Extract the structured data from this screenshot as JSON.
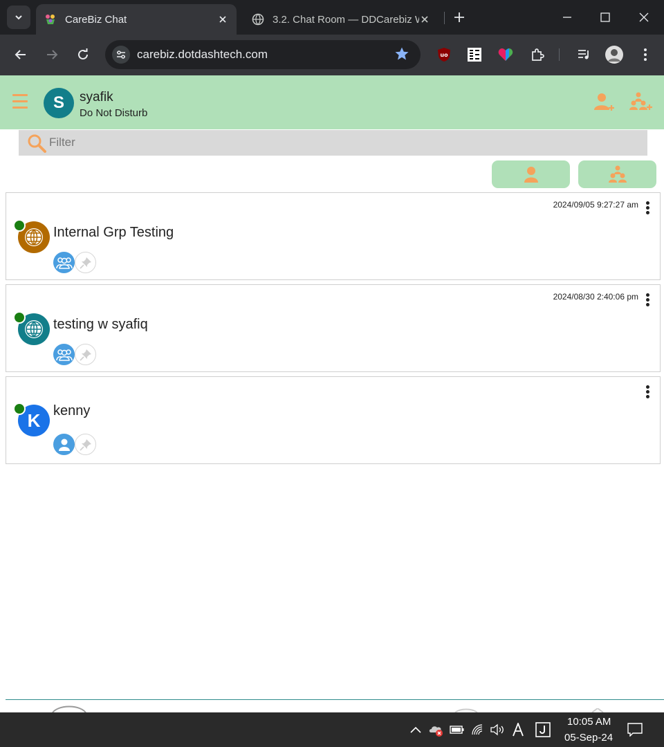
{
  "browser": {
    "tabs": [
      {
        "title": "CareBiz Chat",
        "active": true
      },
      {
        "title": "3.2. Chat Room — DDCarebiz W",
        "active": false
      }
    ],
    "url": "carebiz.dotdashtech.com"
  },
  "header": {
    "user_initial": "S",
    "user_name": "syafik",
    "user_status": "Do Not Disturb"
  },
  "filter": {
    "placeholder": "Filter"
  },
  "chats": [
    {
      "name": "Internal Grp Testing",
      "timestamp": "2024/09/05 9:27:27 am",
      "avatar_icon": "globe-icon",
      "avatar_color": "#b26a00",
      "type": "group",
      "online": true
    },
    {
      "name": "testing w syafiq",
      "timestamp": "2024/08/30 2:40:06 pm",
      "avatar_icon": "globe-icon",
      "avatar_color": "#127e8a",
      "type": "group",
      "online": true
    },
    {
      "name": "kenny",
      "timestamp": "",
      "avatar_initial": "K",
      "avatar_color": "#1a73e8",
      "type": "individual",
      "online": true
    }
  ],
  "taskbar": {
    "time": "10:05 AM",
    "date": "05-Sep-24"
  },
  "colors": {
    "header_bg": "#b0e0b8",
    "accent_orange": "#f5a35b",
    "online_green": "#1a7f12",
    "type_blue": "#4a9ee0"
  }
}
